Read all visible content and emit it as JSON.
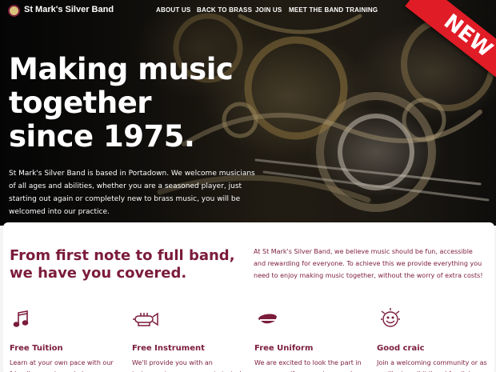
{
  "header": {
    "brand": "St Mark's Silver Band",
    "menu": [
      "ABOUT US",
      "BACK TO BRASS",
      "JOIN US",
      "MEET THE BAND",
      "TRAINING"
    ],
    "ribbon": "NEW"
  },
  "hero": {
    "headline_lines": [
      "Making music",
      "together",
      "since 1975."
    ],
    "lead": "St Mark's Silver Band is based in Portadown. We welcome musicians of all ages and abilities, whether you are a seasoned player, just starting out again or completely new to brass music, you will be welcomed into our practice."
  },
  "intro": {
    "title": "From first note to full band, we have you covered.",
    "text": "At St Mark's Silver Band, we believe music should be fun, accessible and rewarding for everyone. To achieve this we provide everything you need to enjoy making music together, without the worry of extra costs!"
  },
  "features": [
    {
      "icon": "music-note-icon",
      "title": "Free Tuition",
      "text": "Learn at your own pace with our friendly experienced players"
    },
    {
      "icon": "cornet-icon",
      "title": "Free Instrument",
      "text": "We'll provide you with an instrument so you can get started"
    },
    {
      "icon": "band-cap-icon",
      "title": "Free Uniform",
      "text": "We are excited to look the part in our new uniform coming soon!"
    },
    {
      "icon": "smile-icon",
      "title": "Good craic",
      "text": "Join a welcoming community or as we like to call it 'band family'"
    }
  ],
  "colors": {
    "accent": "#7b1c3a",
    "ribbon": "#e01c26"
  }
}
